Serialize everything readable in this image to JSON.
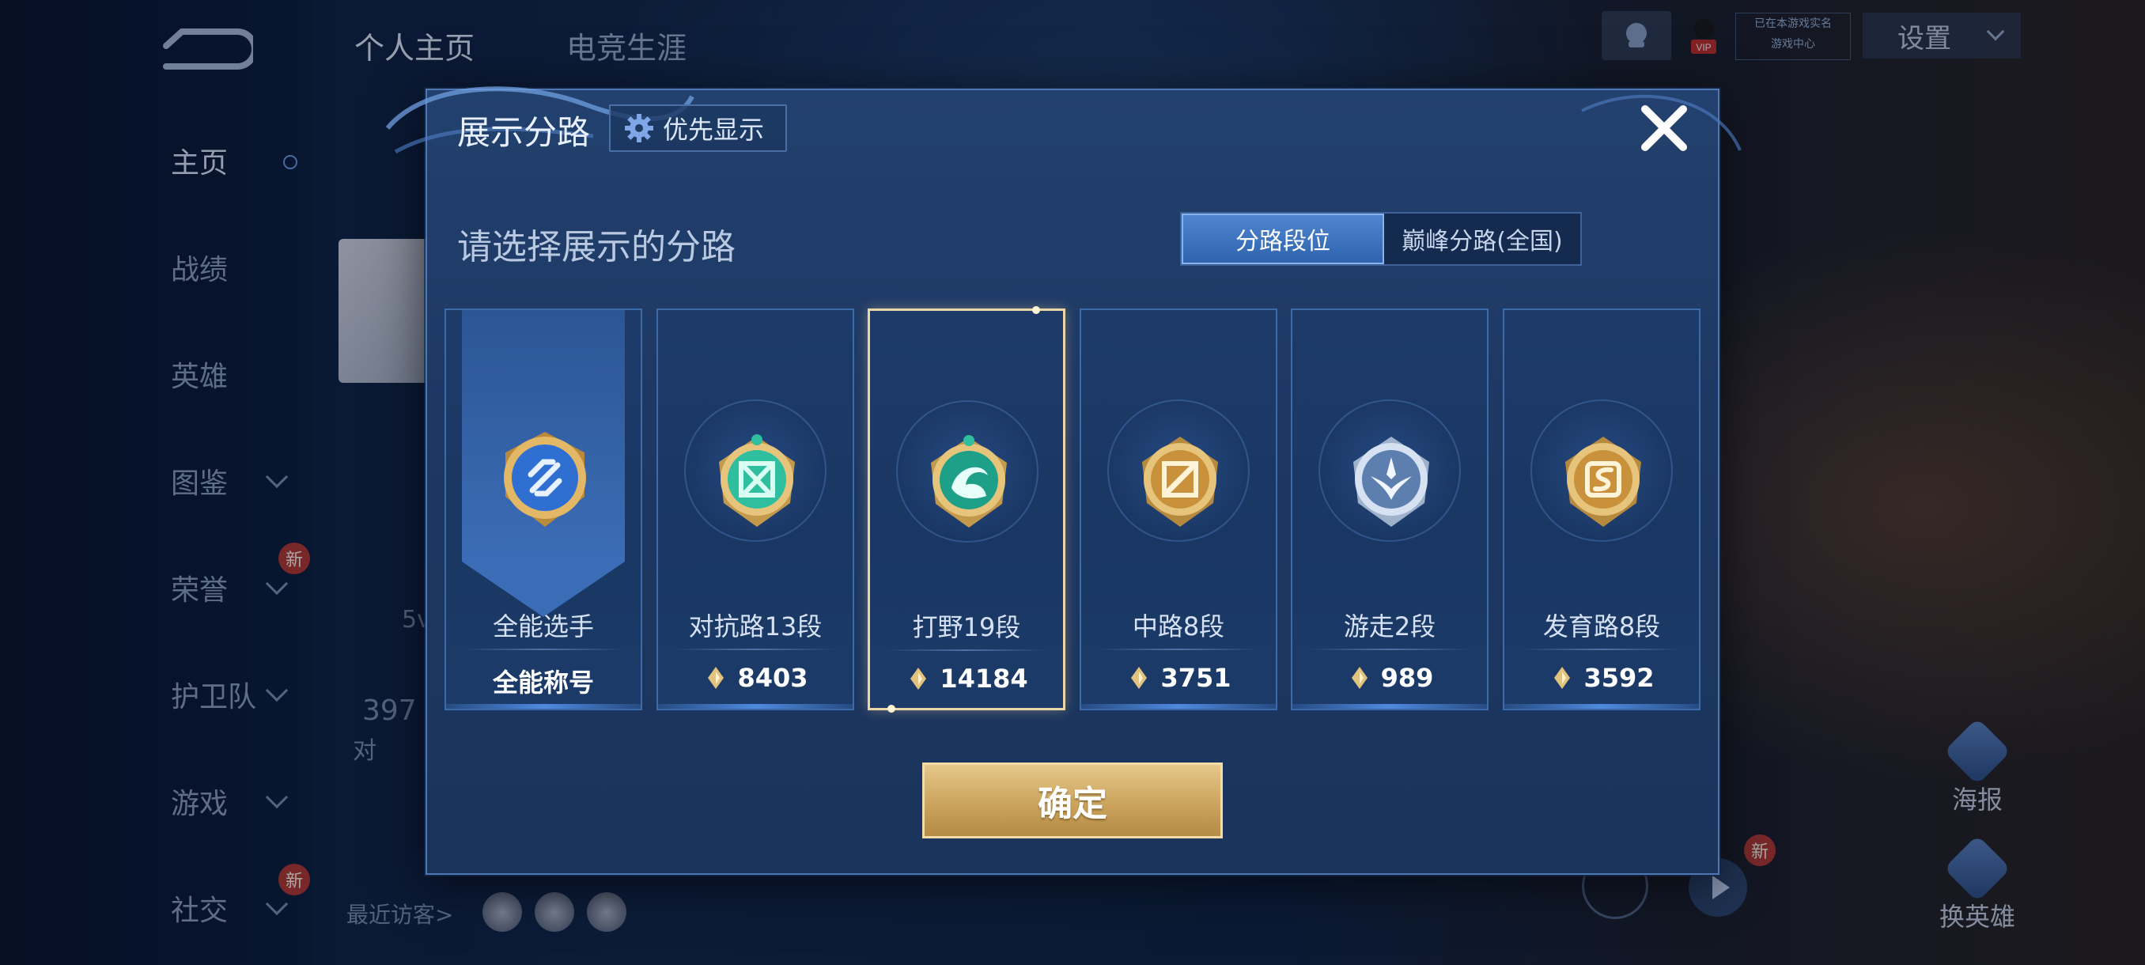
{
  "top_tabs": [
    "个人主页",
    "电竞生涯"
  ],
  "sidebar": {
    "items": [
      {
        "label": "主页",
        "active": true
      },
      {
        "label": "战绩"
      },
      {
        "label": "英雄"
      },
      {
        "label": "图鉴",
        "expandable": true
      },
      {
        "label": "荣誉",
        "expandable": true,
        "badge": "新"
      },
      {
        "label": "护卫队",
        "expandable": true
      },
      {
        "label": "游戏",
        "expandable": true
      },
      {
        "label": "社交",
        "expandable": true,
        "badge": "新"
      }
    ]
  },
  "profile": {
    "partial_number": "5v",
    "partial_count": "397",
    "partial_label": "对",
    "recent_visitors_label": "最近访客>"
  },
  "header_right": {
    "vip_label": "VIP",
    "vip_line1": "已在本游戏实名",
    "vip_line2": "游戏中心",
    "settings_label": "设置"
  },
  "right_side": {
    "poster_label": "海报",
    "change_hero_label": "换英雄",
    "new_badge": "新"
  },
  "modal": {
    "title": "展示分路",
    "priority_label": "优先显示",
    "subtitle": "请选择展示的分路",
    "segments": [
      "分路段位",
      "巅峰分路(全国)"
    ],
    "active_segment": 0,
    "cards": [
      {
        "name": "全能选手",
        "value": "全能称号",
        "emblem": "all-round-emblem-icon",
        "color": "#4d8ee8"
      },
      {
        "name": "对抗路13段",
        "value": "8403",
        "emblem": "clash-lane-emblem-icon",
        "color": "#2fbf9f"
      },
      {
        "name": "打野19段",
        "value": "14184",
        "emblem": "jungle-emblem-icon",
        "color": "#1e9f88",
        "selected": true
      },
      {
        "name": "中路8段",
        "value": "3751",
        "emblem": "mid-lane-emblem-icon",
        "color": "#d9a24a"
      },
      {
        "name": "游走2段",
        "value": "989",
        "emblem": "roam-emblem-icon",
        "color": "#b8c8de"
      },
      {
        "name": "发育路8段",
        "value": "3592",
        "emblem": "farm-lane-emblem-icon",
        "color": "#d9a24a"
      }
    ],
    "confirm_label": "确定"
  }
}
